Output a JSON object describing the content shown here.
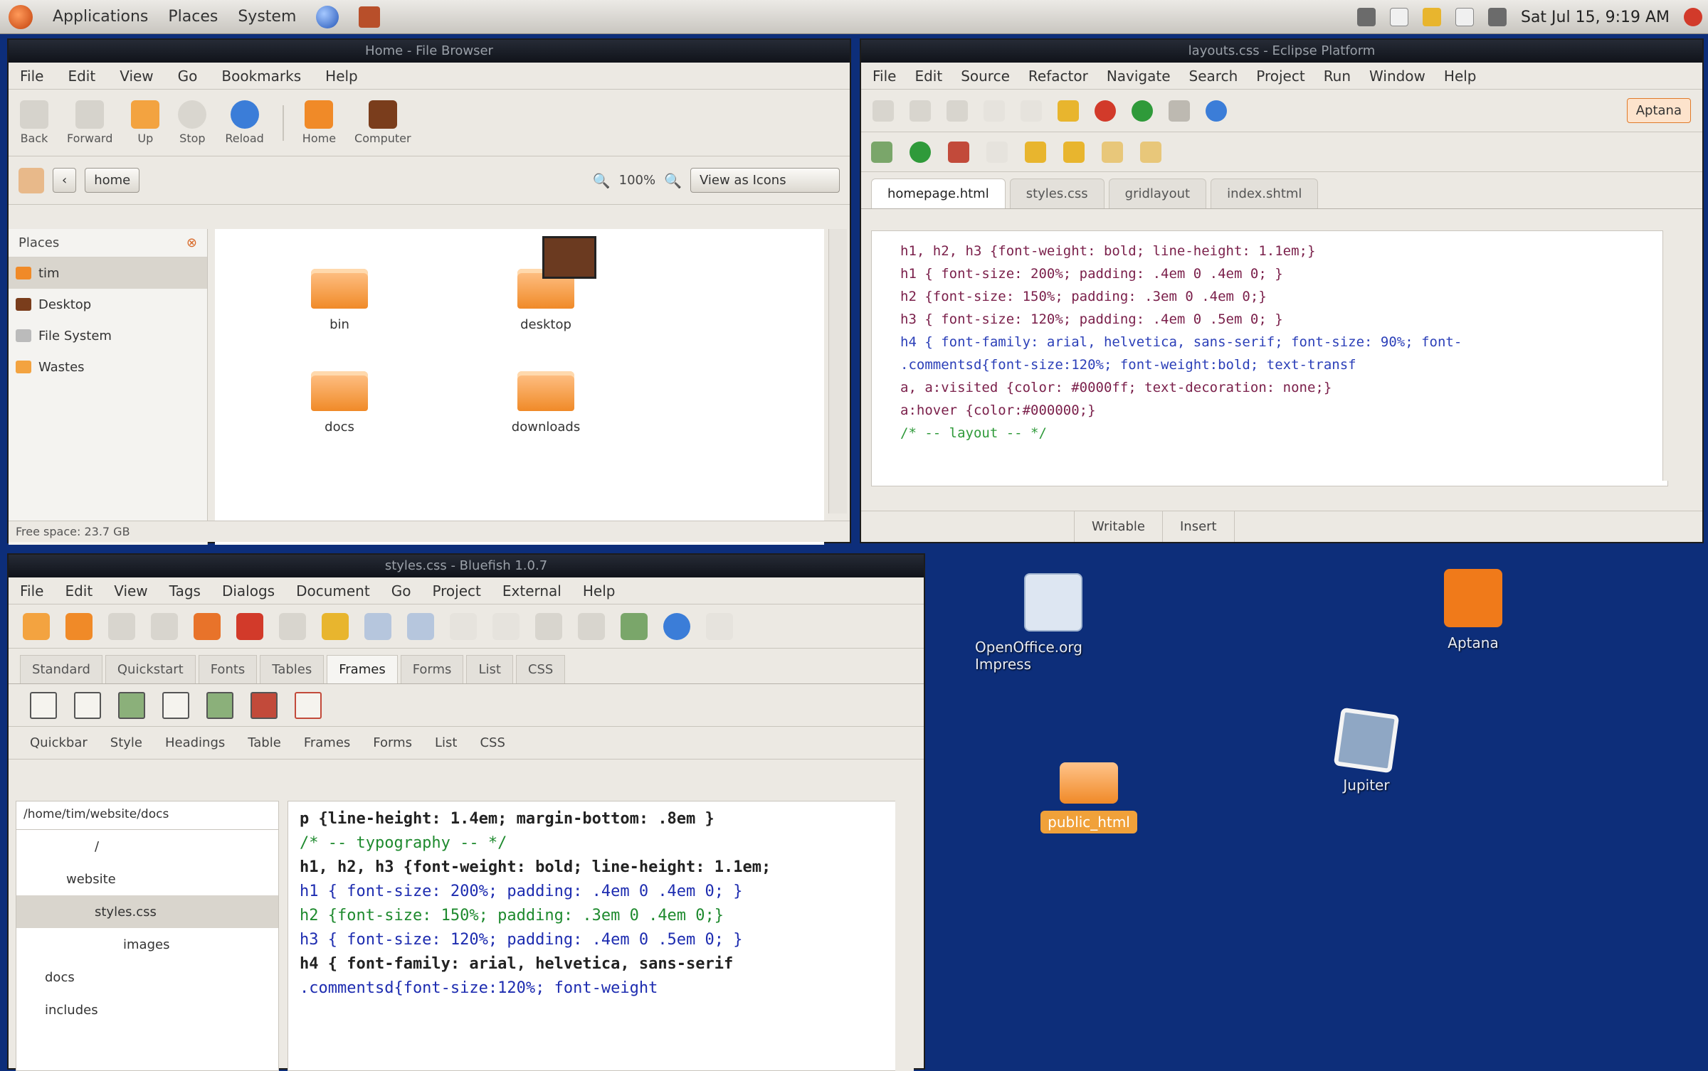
{
  "panel": {
    "menus": [
      "Applications",
      "Places",
      "System"
    ],
    "clock": "Sat Jul 15, 9:19 AM"
  },
  "file_manager": {
    "title": "Home - File Browser",
    "menus": [
      "File",
      "Edit",
      "View",
      "Go",
      "Bookmarks",
      "Help"
    ],
    "toolbar": [
      "Back",
      "Forward",
      "Up",
      "Stop",
      "Reload",
      "Home",
      "Computer"
    ],
    "location_button": "home",
    "zoom": "100%",
    "view_mode": "View as Icons",
    "sidebar_title": "Places",
    "places": [
      "tim",
      "Desktop",
      "File System",
      "Wastes"
    ],
    "items": [
      "bin",
      "desktop",
      "docs",
      "downloads"
    ],
    "status": "Free space: 23.7 GB"
  },
  "ide": {
    "title": "layouts.css - Eclipse Platform",
    "menus": [
      "File",
      "Edit",
      "Source",
      "Refactor",
      "Navigate",
      "Search",
      "Project",
      "Run",
      "Window",
      "Help"
    ],
    "perspective": "Aptana",
    "tabs": [
      "homepage.html",
      "styles.css",
      "gridlayout",
      "index.shtml"
    ],
    "code": [
      "h1, h2, h3 {font-weight: bold; line-height: 1.1em;}",
      "h1 { font-size: 200%; padding: .4em 0 .4em 0; }",
      "h2 {font-size: 150%; padding: .3em 0 .4em 0;}",
      "h3 { font-size: 120%; padding: .4em 0 .5em 0; }",
      "h4 { font-family: arial, helvetica, sans-serif; font-size: 90%; font-",
      ".commentsd{font-size:120%; font-weight:bold; text-transf",
      "a, a:visited {color: #0000ff; text-decoration: none;}",
      "a:hover {color:#000000;}",
      "",
      "/* -- layout -- */"
    ],
    "status": [
      "",
      "Writable",
      "Insert"
    ]
  },
  "editor": {
    "title": "styles.css - Bluefish 1.0.7",
    "menus": [
      "File",
      "Edit",
      "View",
      "Tags",
      "Dialogs",
      "Document",
      "Go",
      "Project",
      "External",
      "Help"
    ],
    "tabs": [
      "Standard",
      "Quickstart",
      "Fonts",
      "Tables",
      "Frames",
      "Forms",
      "List",
      "CSS"
    ],
    "quickbar": [
      "Quickbar",
      "Style",
      "Headings",
      "Table",
      "Frames",
      "Forms",
      "List",
      "CSS"
    ],
    "tree_path": "/home/tim/website/docs",
    "tree": [
      "/",
      "website",
      "styles.css",
      "images",
      "docs",
      "includes"
    ],
    "code": [
      "p {line-height: 1.4em; margin-bottom: .8em }",
      "",
      "",
      "/* -- typography -- */",
      "h1, h2, h3 {font-weight: bold; line-height: 1.1em;",
      "h1 { font-size: 200%; padding: .4em 0 .4em 0; }",
      "h2 {font-size: 150%; padding: .3em 0 .4em 0;}",
      "h3 { font-size: 120%; padding: .4em 0 .5em 0; }",
      "h4 { font-family: arial, helvetica, sans-serif",
      ".commentsd{font-size:120%; font-weight"
    ]
  },
  "desktop": {
    "icons": [
      "OpenOffice.org Impress",
      "Aptana",
      "public_html",
      "Jupiter"
    ]
  },
  "colors": {
    "desktop": "#0d2e7a",
    "accent": "#f0a13a"
  }
}
